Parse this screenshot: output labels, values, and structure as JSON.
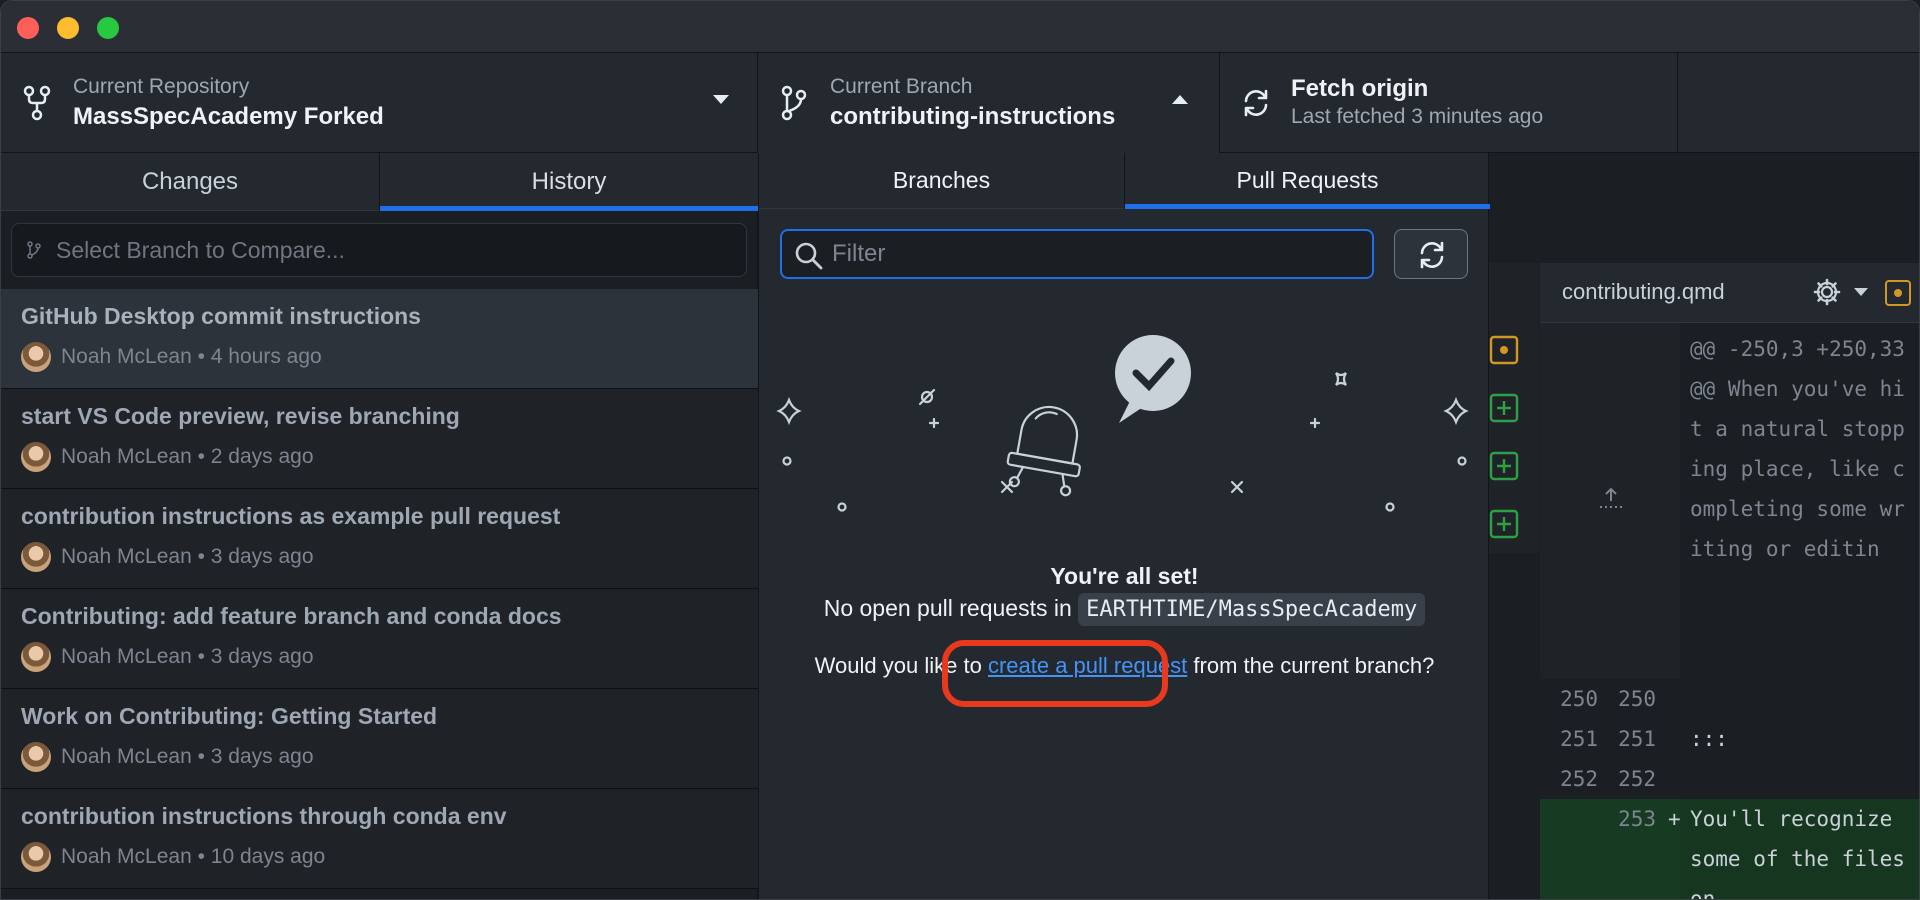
{
  "toolbar": {
    "repo_label": "Current Repository",
    "repo_value": "MassSpecAcademy Forked",
    "branch_label": "Current Branch",
    "branch_value": "contributing-instructions",
    "fetch_title": "Fetch origin",
    "fetch_sub": "Last fetched 3 minutes ago"
  },
  "left": {
    "tab_changes": "Changes",
    "tab_history": "History",
    "compare_placeholder": "Select Branch to Compare...",
    "history": [
      {
        "title": "GitHub Desktop commit instructions",
        "meta": "Noah McLean • 4 hours ago"
      },
      {
        "title": "start VS Code preview, revise branching",
        "meta": "Noah McLean • 2 days ago"
      },
      {
        "title": "contribution instructions as example pull request",
        "meta": "Noah McLean • 3 days ago"
      },
      {
        "title": "Contributing: add feature branch and conda docs",
        "meta": "Noah McLean • 3 days ago"
      },
      {
        "title": "Work on Contributing: Getting Started",
        "meta": "Noah McLean • 3 days ago"
      },
      {
        "title": "contribution instructions through conda env",
        "meta": "Noah McLean • 10 days ago"
      }
    ]
  },
  "popup": {
    "tab_branches": "Branches",
    "tab_pulls": "Pull Requests",
    "filter_placeholder": "Filter",
    "allset": "You're all set!",
    "noopen_prefix": "No open pull requests in",
    "repo_code": "EARTHTIME/MassSpecAcademy",
    "would_prefix": "Would you like to",
    "link": "create a pull request",
    "would_suffix": "from the current branch?"
  },
  "diff": {
    "filename": "contributing.qmd",
    "hunk": "@@ -250,3 +250,33 @@ When you've hit a natural stopping place, like completing some writing or editin",
    "rows": [
      {
        "old": "250",
        "new": "250",
        "text": ""
      },
      {
        "old": "251",
        "new": "251",
        "text": ":::"
      },
      {
        "old": "252",
        "new": "252",
        "text": ""
      }
    ],
    "added_new": "253",
    "added_sign": "+",
    "added_text": "You'll recognize some of the files on"
  },
  "colors": {
    "accent": "#1f6feb",
    "link": "#4493f8",
    "highlight": "#e8391f",
    "added": "#2ea043",
    "modified": "#d29922"
  }
}
